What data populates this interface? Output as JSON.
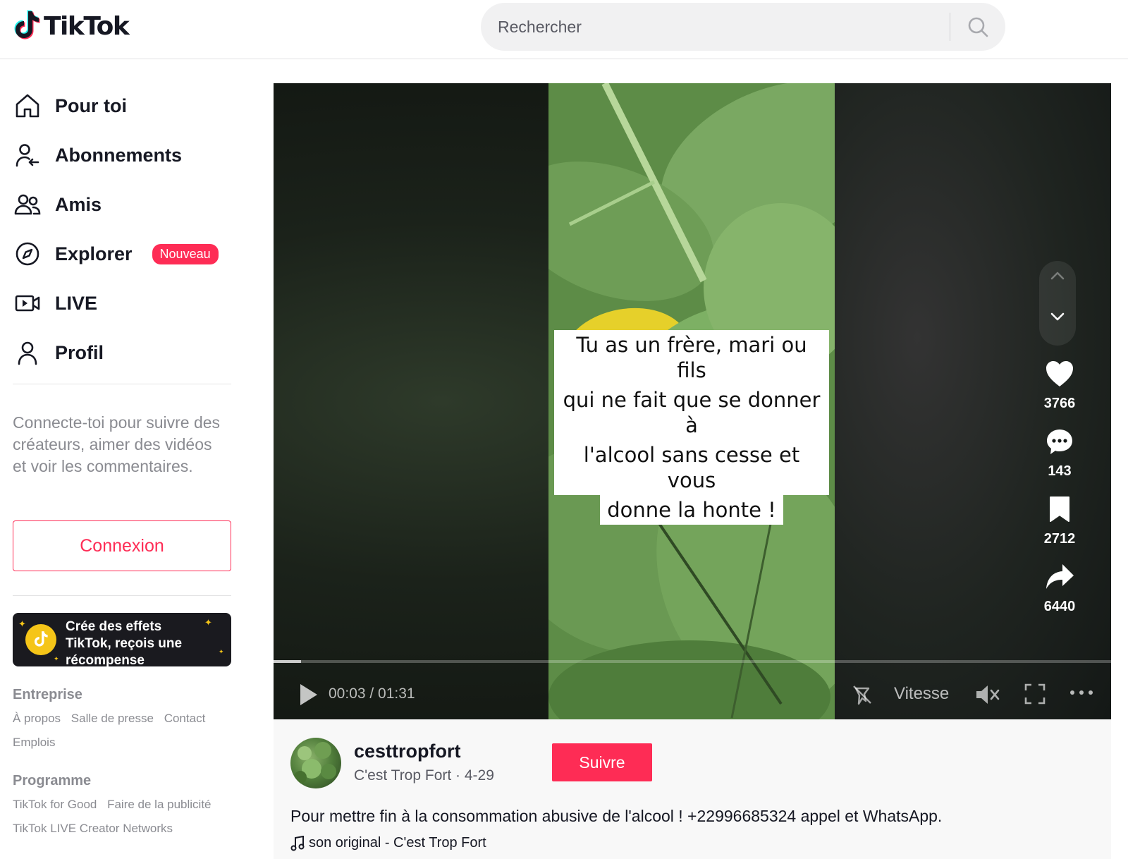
{
  "header": {
    "logo_text": "TikTok",
    "search_placeholder": "Rechercher"
  },
  "sidebar": {
    "nav": [
      {
        "label": "Pour toi",
        "icon": "home-icon"
      },
      {
        "label": "Abonnements",
        "icon": "following-icon"
      },
      {
        "label": "Amis",
        "icon": "friends-icon"
      },
      {
        "label": "Explorer",
        "icon": "compass-icon",
        "badge": "Nouveau"
      },
      {
        "label": "LIVE",
        "icon": "live-icon"
      },
      {
        "label": "Profil",
        "icon": "profile-icon"
      }
    ],
    "login_hint": "Connecte-toi pour suivre des créateurs, aimer des vidéos et voir les commentaires.",
    "login_button": "Connexion",
    "effects_banner": "Crée des effets TikTok, reçois une récompense",
    "footer": {
      "company_title": "Entreprise",
      "company_links": [
        "À propos",
        "Salle de presse",
        "Contact",
        "Emplois"
      ],
      "program_title": "Programme",
      "program_links": [
        "TikTok for Good",
        "Faire de la publicité",
        "TikTok LIVE Creator Networks"
      ]
    }
  },
  "video": {
    "caption_lines": [
      "Tu as un frère, mari ou fils",
      "qui ne fait que se donner à",
      "l'alcool sans cesse et vous",
      "donne la honte !"
    ],
    "time": "00:03 / 01:31",
    "progress": 0.033,
    "speed_label": "Vitesse",
    "likes": "3766",
    "comments": "143",
    "saves": "2712",
    "shares": "6440"
  },
  "post": {
    "username": "cesttropfort",
    "nickname_date": "C'est Trop Fort · 4-29",
    "follow_button": "Suivre",
    "description": "Pour mettre fin à la consommation abusive de l'alcool ! +22996685324 appel et WhatsApp.",
    "music": "son original - C'est Trop Fort"
  },
  "colors": {
    "accent": "#fe2c55",
    "text": "#161823",
    "muted": "#8a8b91"
  }
}
